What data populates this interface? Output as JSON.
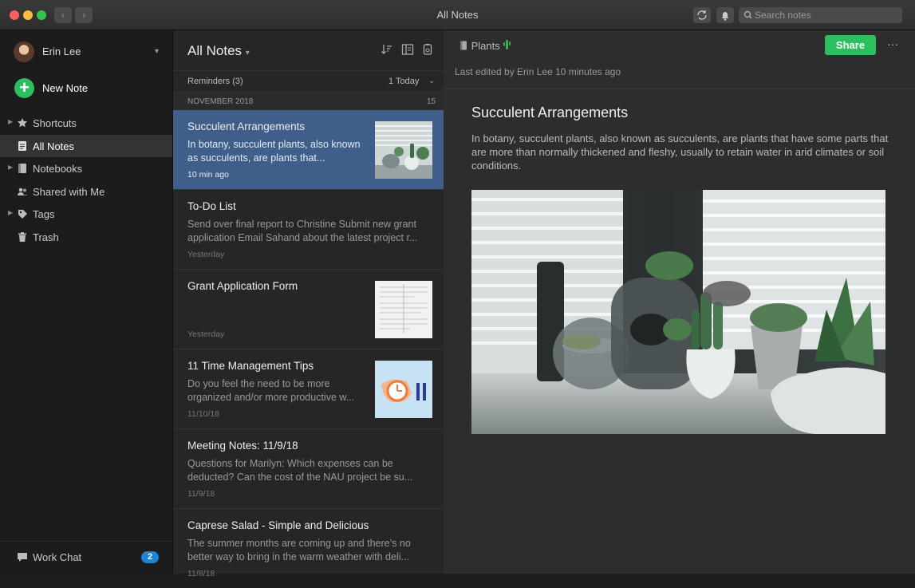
{
  "window": {
    "title": "All Notes",
    "search_placeholder": "Search notes"
  },
  "sidebar": {
    "user_name": "Erin Lee",
    "new_note_label": "New Note",
    "items": [
      {
        "label": "Shortcuts",
        "icon": "star-icon",
        "expandable": true
      },
      {
        "label": "All Notes",
        "icon": "note-icon",
        "expandable": false,
        "active": true
      },
      {
        "label": "Notebooks",
        "icon": "notebook-icon",
        "expandable": true
      },
      {
        "label": "Shared with Me",
        "icon": "people-icon",
        "expandable": false
      },
      {
        "label": "Tags",
        "icon": "tag-icon",
        "expandable": true
      },
      {
        "label": "Trash",
        "icon": "trash-icon",
        "expandable": false
      }
    ],
    "work_chat": {
      "label": "Work Chat",
      "count": "2"
    }
  },
  "notelist": {
    "title": "All Notes",
    "reminders_label": "Reminders (3)",
    "reminders_today": "1 Today",
    "month_label": "NOVEMBER 2018",
    "month_count": "15",
    "notes": [
      {
        "title": "Succulent Arrangements",
        "snippet": "In botany, succulent plants, also known as succulents, are plants that...",
        "date": "10 min ago",
        "thumbnail": "plants",
        "selected": true
      },
      {
        "title": "To-Do List",
        "snippet": "Send over final report to Christine Submit new grant application Email Sahand about the latest project r...",
        "date": "Yesterday"
      },
      {
        "title": "Grant Application Form",
        "snippet": "",
        "date": "Yesterday",
        "thumbnail": "document"
      },
      {
        "title": "11 Time Management Tips",
        "snippet": "Do you feel the need to be more organized and/or more productive w...",
        "date": "11/10/18",
        "thumbnail": "stopwatch"
      },
      {
        "title": "Meeting Notes: 11/9/18",
        "snippet": "Questions for Marilyn: Which expenses can be deducted? Can the cost of the NAU project be su...",
        "date": "11/9/18"
      },
      {
        "title": "Caprese Salad - Simple and Delicious",
        "snippet": "The summer months are coming up and there’s no better way to bring in the warm weather with deli...",
        "date": "11/8/18"
      }
    ]
  },
  "editor": {
    "notebook": "Plants",
    "share_label": "Share",
    "more_label": "···",
    "last_edited": "Last edited by Erin Lee 10 minutes ago",
    "note_title": "Succulent Arrangements",
    "note_body": "In botany, succulent plants, also known as succulents, are plants that have some parts that are more than normally thickened and fleshy, usually to retain water in arid climates or soil conditions."
  },
  "colors": {
    "accent_green": "#2dbe60",
    "selection_blue": "#3f5e8a",
    "badge_blue": "#1a84d6"
  }
}
